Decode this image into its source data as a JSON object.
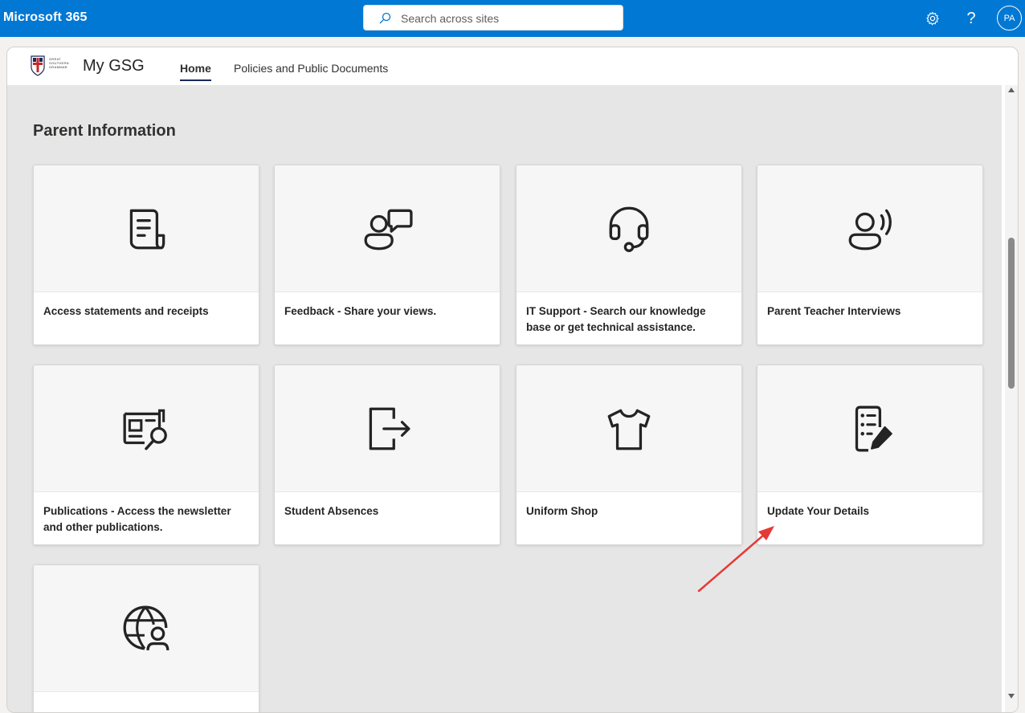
{
  "suite": {
    "title": "Microsoft 365",
    "search_placeholder": "Search across sites",
    "avatar_initials": "PA",
    "help_glyph": "?",
    "color": "#0078d4"
  },
  "site": {
    "title": "My GSG",
    "logo_text": [
      "GREAT",
      "SOUTHERN",
      "GRAMMAR"
    ],
    "nav": [
      {
        "label": "Home",
        "active": true
      },
      {
        "label": "Policies and Public Documents",
        "active": false
      }
    ]
  },
  "section": {
    "title": "Parent Information",
    "cards": [
      {
        "label": "Access statements and receipts",
        "icon": "receipt-icon"
      },
      {
        "label": "Feedback - Share your views.",
        "icon": "person-feedback-icon"
      },
      {
        "label": "IT Support - Search our knowledge base or get technical assistance.",
        "icon": "headset-icon"
      },
      {
        "label": "Parent Teacher Interviews",
        "icon": "person-voice-icon"
      },
      {
        "label": "Publications - Access the newsletter and other publications.",
        "icon": "news-search-icon"
      },
      {
        "label": "Student Absences",
        "icon": "sign-out-icon"
      },
      {
        "label": "Uniform Shop",
        "icon": "tshirt-icon"
      },
      {
        "label": "Update Your Details",
        "icon": "form-edit-icon"
      },
      {
        "label": "",
        "icon": "globe-person-icon"
      }
    ]
  },
  "annotation": {
    "color": "#e53935",
    "target": "Update Your Details"
  }
}
